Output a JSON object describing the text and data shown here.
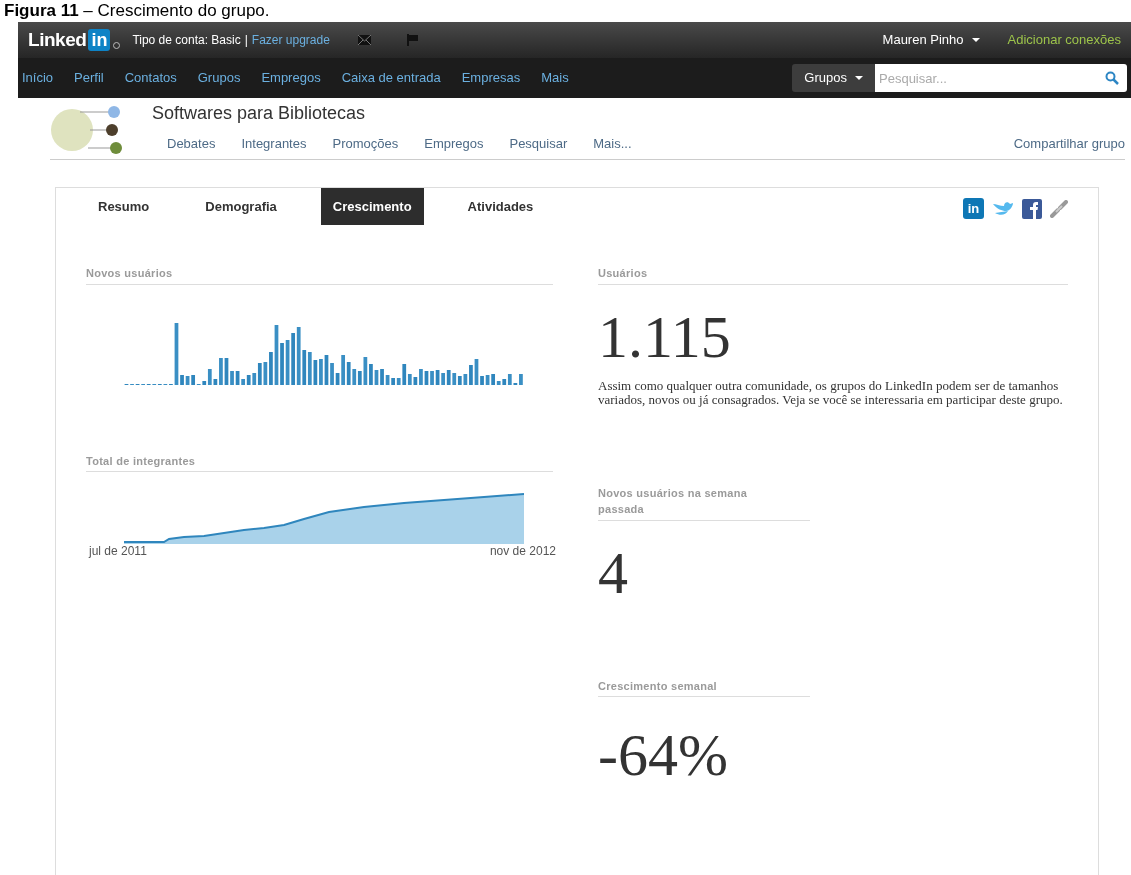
{
  "caption": "**Figura 11** – Crescimento do grupo.",
  "topbar": {
    "logo_word": "Linked",
    "logo_box": "in",
    "account_type": "Tipo de conta: Basic",
    "separator": "|",
    "upgrade_link": "Fazer upgrade",
    "user": "Mauren Pinho",
    "add_connections": "Adicionar conexões"
  },
  "nav": {
    "items": [
      "Início",
      "Perfil",
      "Contatos",
      "Grupos",
      "Empregos",
      "Caixa de entrada",
      "Empresas",
      "Mais"
    ],
    "search": {
      "scope": "Grupos",
      "placeholder": "Pesquisar..."
    }
  },
  "group": {
    "name": "Softwares para Bibliotecas",
    "tabs": [
      "Debates",
      "Integrantes",
      "Promoções",
      "Empregos",
      "Pesquisar",
      "Mais..."
    ],
    "share": "Compartilhar grupo"
  },
  "share_linkedin": "in",
  "stats_tabs": [
    {
      "label": "Resumo",
      "selected": false
    },
    {
      "label": "Demografia",
      "selected": false
    },
    {
      "label": "Crescimento",
      "selected": true
    },
    {
      "label": "Atividades",
      "selected": false
    }
  ],
  "new_users": {
    "title": "Novos usuários"
  },
  "total_members": {
    "title": "Total de integrantes",
    "x_start": "jul de 2011",
    "x_end": "nov de 2012"
  },
  "users": {
    "title": "Usuários",
    "value": "1.115",
    "description": "Assim como qualquer outra comunidade, os grupos do LinkedIn podem ser de tamanhos variados, novos ou já consagrados. Veja se você se interessaria em participar deste grupo."
  },
  "weekly_new": {
    "title": "Novos usuários na semana passada",
    "value": "4"
  },
  "weekly_growth": {
    "title": "Crescimento semanal",
    "value": "-64%"
  }
}
